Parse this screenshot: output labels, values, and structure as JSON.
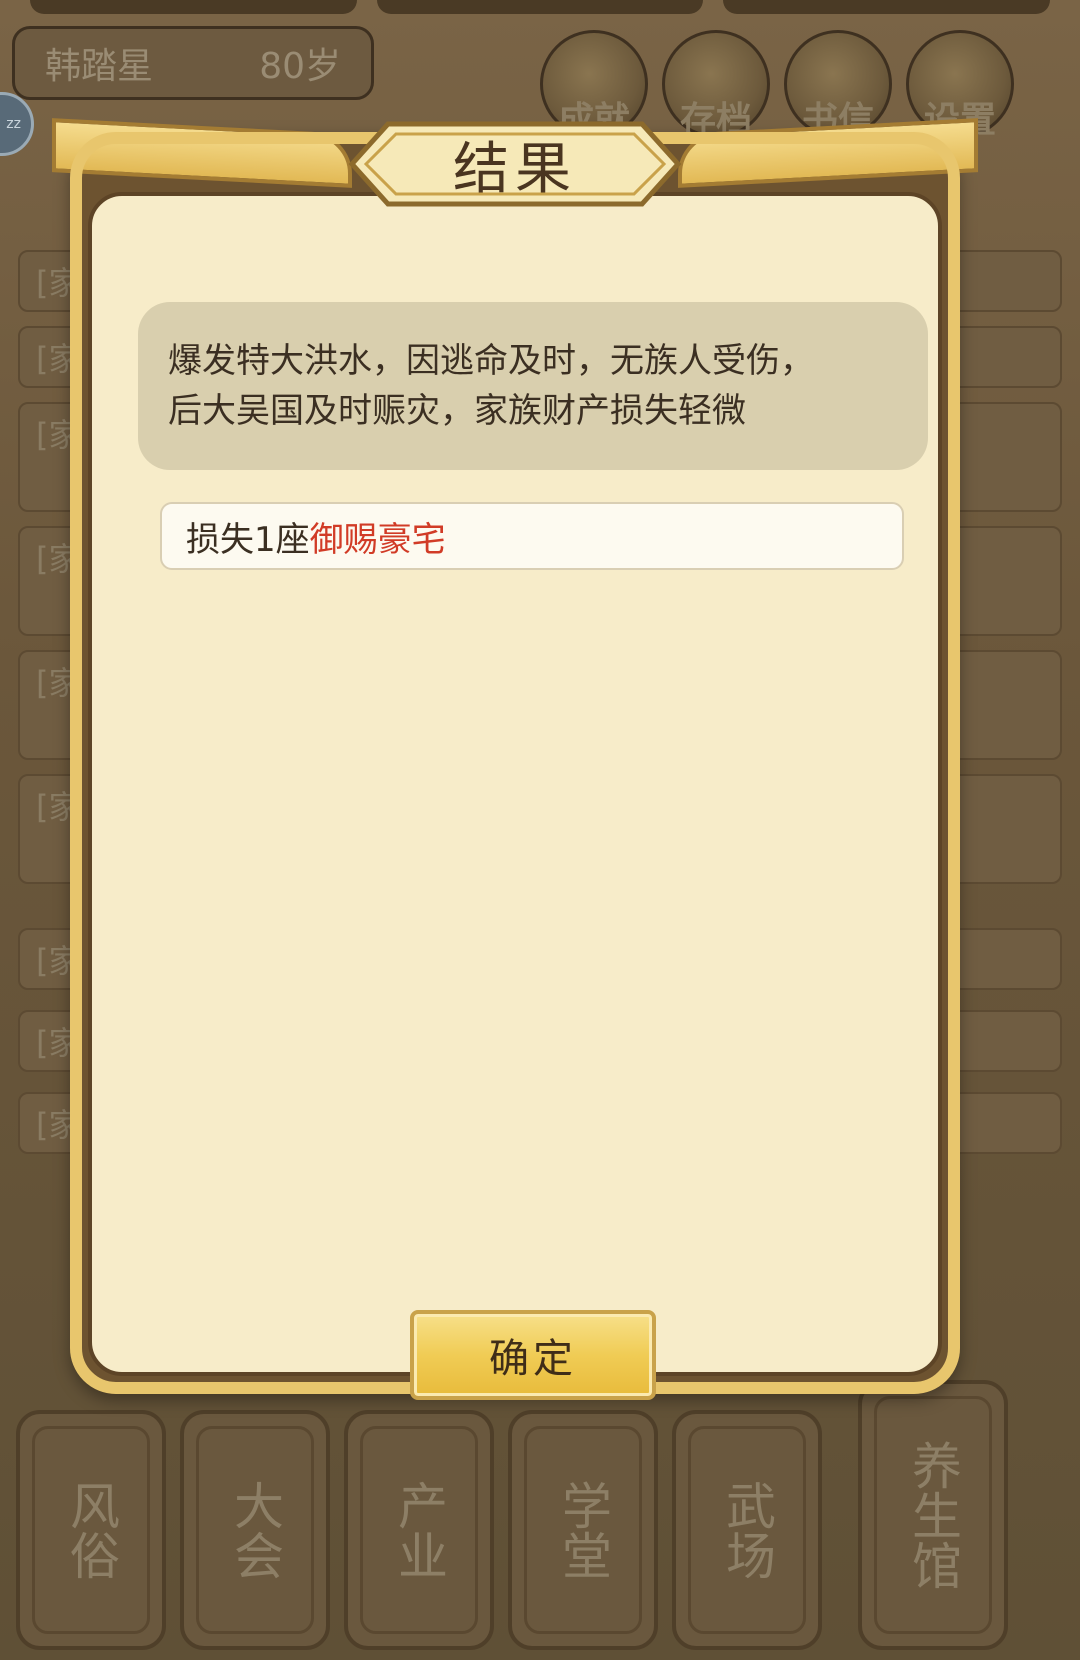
{
  "background": {
    "player_name": "韩踏星",
    "player_age": "80岁",
    "top_buttons": [
      {
        "label": "成就",
        "icon": "achievement-icon"
      },
      {
        "label": "存档",
        "icon": "save-icon"
      },
      {
        "label": "书信",
        "icon": "letter-icon"
      },
      {
        "label": "设置",
        "icon": "settings-icon"
      }
    ],
    "feed_rows": [
      "[家",
      "[家",
      "[家",
      "[家",
      "[家",
      "[家",
      "[家",
      "[家",
      "[家"
    ],
    "bottom_tabs": [
      {
        "label": "风俗"
      },
      {
        "label": "大会"
      },
      {
        "label": "产业"
      },
      {
        "label": "学堂"
      },
      {
        "label": "武场"
      },
      {
        "label": "养生馆"
      }
    ]
  },
  "dialog": {
    "title": "结果",
    "story_line1": "爆发特大洪水，因逃命及时，无族人受伤，",
    "story_line2": "后大吴国及时赈灾，家族财产损失轻微",
    "result_prefix": "损失1座",
    "result_highlight": "御赐豪宅",
    "confirm_label": "确定"
  },
  "colors": {
    "highlight_red": "#d13b26",
    "parchment": "#f7ecc9",
    "gold": "#f0cc55"
  }
}
